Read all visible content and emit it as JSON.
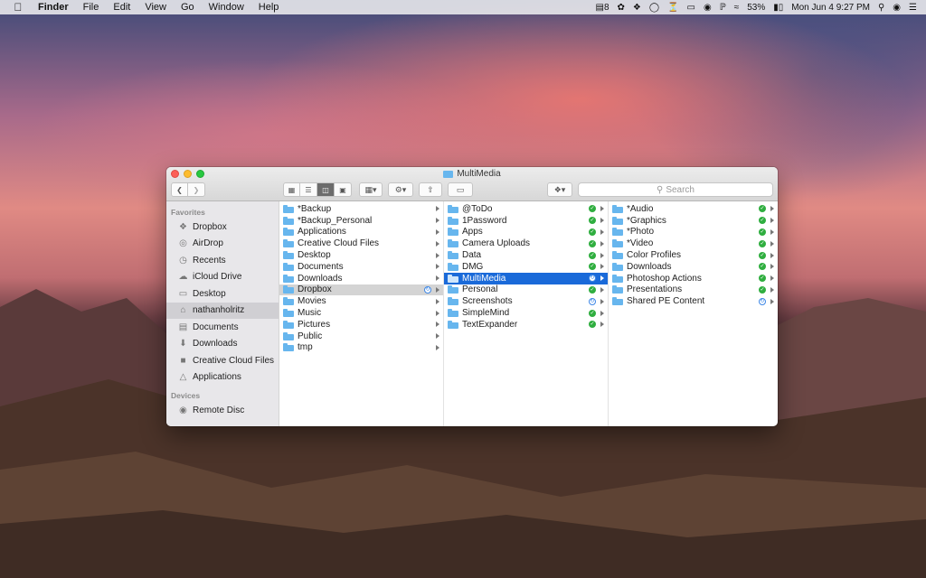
{
  "menubar": {
    "app": "Finder",
    "menus": [
      "File",
      "Edit",
      "View",
      "Go",
      "Window",
      "Help"
    ],
    "status": {
      "notif_count": "8",
      "battery": "53%",
      "clock": "Mon Jun 4  9:27 PM"
    }
  },
  "window": {
    "title": "MultiMedia",
    "search_placeholder": "Search"
  },
  "sidebar": {
    "favorites_header": "Favorites",
    "favorites": [
      {
        "label": "Dropbox",
        "icon": "dropbox-icon"
      },
      {
        "label": "AirDrop",
        "icon": "airdrop-icon"
      },
      {
        "label": "Recents",
        "icon": "clock-icon"
      },
      {
        "label": "iCloud Drive",
        "icon": "cloud-icon"
      },
      {
        "label": "Desktop",
        "icon": "desktop-icon"
      },
      {
        "label": "nathanholritz",
        "icon": "home-icon"
      },
      {
        "label": "Documents",
        "icon": "document-icon"
      },
      {
        "label": "Downloads",
        "icon": "download-icon"
      },
      {
        "label": "Creative Cloud Files",
        "icon": "folder-icon"
      },
      {
        "label": "Applications",
        "icon": "applications-icon"
      }
    ],
    "devices_header": "Devices",
    "devices": [
      {
        "label": "Remote Disc",
        "icon": "disc-icon"
      }
    ]
  },
  "columns": [
    [
      {
        "name": "*Backup"
      },
      {
        "name": "*Backup_Personal"
      },
      {
        "name": "Applications"
      },
      {
        "name": "Creative Cloud Files"
      },
      {
        "name": "Desktop"
      },
      {
        "name": "Documents"
      },
      {
        "name": "Downloads"
      },
      {
        "name": "Dropbox",
        "badge": "sync",
        "selected": "gray"
      },
      {
        "name": "Movies"
      },
      {
        "name": "Music"
      },
      {
        "name": "Pictures"
      },
      {
        "name": "Public"
      },
      {
        "name": "tmp"
      }
    ],
    [
      {
        "name": "@ToDo",
        "badge": "ok"
      },
      {
        "name": "1Password",
        "badge": "ok"
      },
      {
        "name": "Apps",
        "badge": "ok"
      },
      {
        "name": "Camera Uploads",
        "badge": "ok"
      },
      {
        "name": "Data",
        "badge": "ok"
      },
      {
        "name": "DMG",
        "badge": "ok"
      },
      {
        "name": "MultiMedia",
        "badge": "sync",
        "selected": "blue"
      },
      {
        "name": "Personal",
        "badge": "ok"
      },
      {
        "name": "Screenshots",
        "badge": "sync"
      },
      {
        "name": "SimpleMind",
        "badge": "ok"
      },
      {
        "name": "TextExpander",
        "badge": "ok"
      }
    ],
    [
      {
        "name": "*Audio",
        "badge": "ok"
      },
      {
        "name": "*Graphics",
        "badge": "ok"
      },
      {
        "name": "*Photo",
        "badge": "ok"
      },
      {
        "name": "*Video",
        "badge": "ok"
      },
      {
        "name": "Color Profiles",
        "badge": "ok"
      },
      {
        "name": "Downloads",
        "badge": "ok"
      },
      {
        "name": "Photoshop Actions",
        "badge": "ok"
      },
      {
        "name": "Presentations",
        "badge": "ok"
      },
      {
        "name": "Shared PE Content",
        "badge": "sync"
      }
    ]
  ],
  "colors": {
    "selection_blue": "#1a6ad9",
    "folder_blue": "#67b6ee",
    "synced_green": "#2fae3f"
  }
}
